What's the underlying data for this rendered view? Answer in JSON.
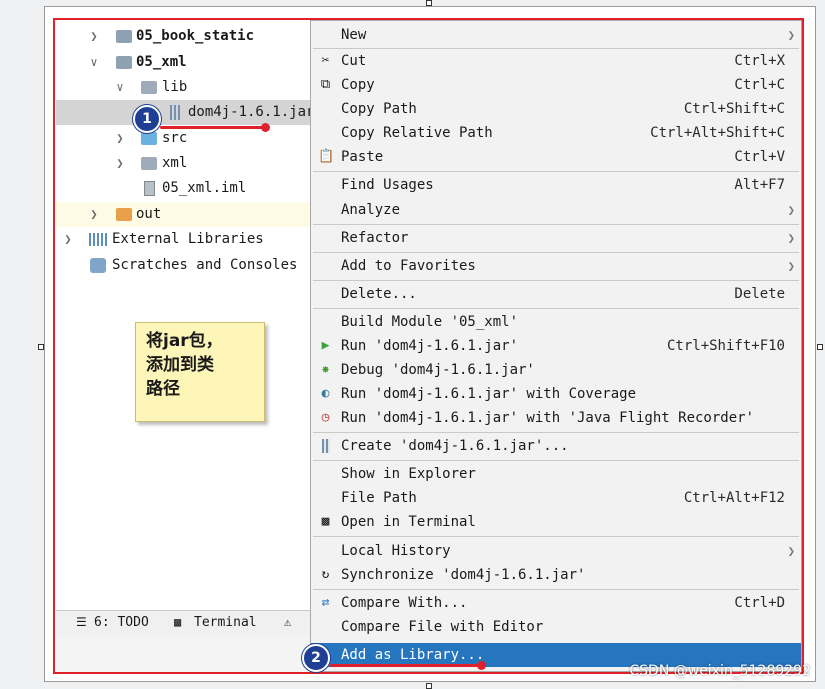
{
  "tree": {
    "items": [
      {
        "label": "05_book_static"
      },
      {
        "label": "05_xml"
      },
      {
        "label": "lib"
      },
      {
        "label": "dom4j-1.6.1.jar"
      },
      {
        "label": "src"
      },
      {
        "label": "xml"
      },
      {
        "label": "05_xml.iml"
      },
      {
        "label": "out"
      },
      {
        "label": "External Libraries"
      },
      {
        "label": "Scratches and Consoles"
      }
    ]
  },
  "bottom_bar": {
    "todo": "6: TODO",
    "terminal": "Terminal"
  },
  "note": {
    "text": "将jar包，\n添加到类\n路径"
  },
  "context_menu": {
    "items": [
      {
        "label": "New",
        "shortcut": ""
      },
      {
        "label": "Cut",
        "shortcut": "Ctrl+X"
      },
      {
        "label": "Copy",
        "shortcut": "Ctrl+C"
      },
      {
        "label": "Copy Path",
        "shortcut": "Ctrl+Shift+C"
      },
      {
        "label": "Copy Relative Path",
        "shortcut": "Ctrl+Alt+Shift+C"
      },
      {
        "label": "Paste",
        "shortcut": "Ctrl+V"
      },
      {
        "label": "Find Usages",
        "shortcut": "Alt+F7"
      },
      {
        "label": "Analyze",
        "shortcut": ""
      },
      {
        "label": "Refactor",
        "shortcut": ""
      },
      {
        "label": "Add to Favorites",
        "shortcut": ""
      },
      {
        "label": "Delete...",
        "shortcut": "Delete"
      },
      {
        "label": "Build Module '05_xml'",
        "shortcut": ""
      },
      {
        "label": "Run 'dom4j-1.6.1.jar'",
        "shortcut": "Ctrl+Shift+F10"
      },
      {
        "label": "Debug 'dom4j-1.6.1.jar'",
        "shortcut": ""
      },
      {
        "label": "Run 'dom4j-1.6.1.jar' with Coverage",
        "shortcut": ""
      },
      {
        "label": "Run 'dom4j-1.6.1.jar' with 'Java Flight Recorder'",
        "shortcut": ""
      },
      {
        "label": "Create 'dom4j-1.6.1.jar'...",
        "shortcut": ""
      },
      {
        "label": "Show in Explorer",
        "shortcut": ""
      },
      {
        "label": "File Path",
        "shortcut": "Ctrl+Alt+F12"
      },
      {
        "label": "Open in Terminal",
        "shortcut": ""
      },
      {
        "label": "Local History",
        "shortcut": ""
      },
      {
        "label": "Synchronize 'dom4j-1.6.1.jar'",
        "shortcut": ""
      },
      {
        "label": "Compare With...",
        "shortcut": "Ctrl+D"
      },
      {
        "label": "Compare File with Editor",
        "shortcut": ""
      },
      {
        "label": "Add as Library...",
        "shortcut": ""
      }
    ]
  },
  "badges": {
    "first": "1",
    "second": "2"
  },
  "colors": {
    "highlight": "#2675bf",
    "annotation_red": "#e0202a",
    "badge_blue": "#1f3f95"
  },
  "watermark": "CSDN @weixin_51289292"
}
